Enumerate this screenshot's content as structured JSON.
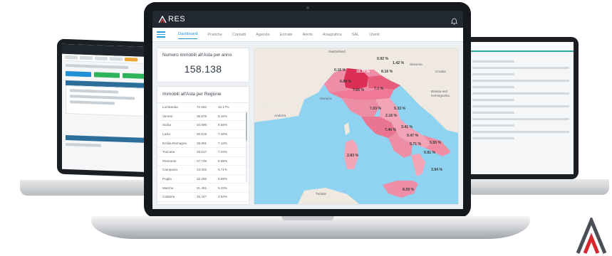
{
  "app": {
    "logo_text": "RES",
    "nav": [
      "Dashboard",
      "Pratiche",
      "Contatti",
      "Agenda",
      "Entrate",
      "Alerts",
      "Anagrafica",
      "SAL",
      "Utenti"
    ],
    "active_nav": "Dashboard"
  },
  "summary": {
    "title": "Numero immobili all'Asta per anno",
    "value": "158.138"
  },
  "regions": {
    "title": "Immobili all'Asta per Regione",
    "rows": [
      {
        "name": "Lombardia",
        "count": "72.652",
        "pct": "16.17%"
      },
      {
        "name": "Veneto",
        "count": "36.878",
        "pct": "8.16%"
      },
      {
        "name": "Sicilia",
        "count": "34.596",
        "pct": "8.59%"
      },
      {
        "name": "Lazio",
        "count": "30.519",
        "pct": "7.48%"
      },
      {
        "name": "Emilia-Romagna",
        "count": "28.801",
        "pct": "7.13%"
      },
      {
        "name": "Toscana",
        "count": "28.517",
        "pct": "7.03%"
      },
      {
        "name": "Piemonte",
        "count": "27.749",
        "pct": "6.89%"
      },
      {
        "name": "Campania",
        "count": "23.002",
        "pct": "5.71%"
      },
      {
        "name": "Puglia",
        "count": "22.265",
        "pct": "5.55%"
      },
      {
        "name": "Marche",
        "count": "21.481",
        "pct": "5.33%"
      },
      {
        "name": "Calabria",
        "count": "15.447",
        "pct": "3.84%"
      }
    ]
  },
  "map": {
    "labels": [
      "0.92 %",
      "1.42 %",
      "0.16 %",
      "18.37 %",
      "8.16 %",
      "6.89 %",
      "7.26 %",
      "7.1 %",
      "7.03 %",
      "5.33 %",
      "2.16 %",
      "7.46 %",
      "3.41 %",
      "0.47 %",
      "5.55 %",
      "5.71 %",
      "0.81 %",
      "2.83 %",
      "3.84 %",
      "8.59 %"
    ],
    "places": [
      "Switzerland",
      "Slovenia",
      "Croatia",
      "Bosnia and Herzegovina",
      "Monaco",
      "Andorra",
      "Tunisia"
    ],
    "colors": {
      "sea": "#8fd3f0",
      "land": "#efe9e2",
      "region_light": "#f6b6c4",
      "region_mid": "#ee8ea6",
      "region_dark": "#dc2f55"
    }
  },
  "icons": {
    "bell": "bell-icon",
    "menu": "hamburger-menu-icon",
    "logo": "ares-logo-icon",
    "brand_corner": "ares-brand-mark-icon"
  },
  "left_laptop": {
    "panel_header_1": "",
    "panel_header_2": ""
  }
}
